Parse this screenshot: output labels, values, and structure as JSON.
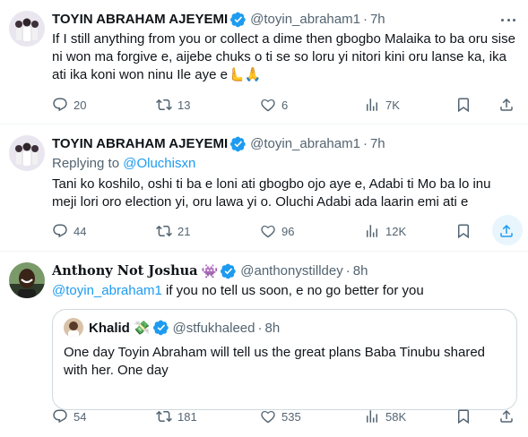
{
  "tweets": [
    {
      "name": "TOYIN ABRAHAM AJEYEMI",
      "handle": "@toyin_abraham1",
      "dot": "·",
      "time": "7h",
      "text": "If I still anything from you or collect a dime then gbogbo Malaika to ba oru sise ni won ma forgive e, aijebe chuks o ti se so loru yi nitori kini oru lanse ka, ika ati ika koni won ninu Ile aye e🫷🙏",
      "actions": {
        "replies": "20",
        "reposts": "13",
        "likes": "6",
        "views": "7K"
      }
    },
    {
      "name": "TOYIN ABRAHAM AJEYEMI",
      "handle": "@toyin_abraham1",
      "dot": "·",
      "time": "7h",
      "replying_label": "Replying to",
      "replying_handle": "@Oluchisxn",
      "text": "Tani ko koshilo, oshi ti ba e loni ati gbogbo ojo aye e, Adabi ti Mo ba lo inu meji lori oro election yi, oru lawa yi o. Oluchi Adabi ada laarin emi ati e",
      "actions": {
        "replies": "44",
        "reposts": "21",
        "likes": "96",
        "views": "12K"
      }
    },
    {
      "name": "Anthony Not Joshua",
      "name_emoji": "👾",
      "handle": "@anthonystilldey",
      "dot": "·",
      "time": "8h",
      "mention": "@toyin_abraham1",
      "text": " if you no tell us soon, e no go better for you",
      "quote": {
        "name": "Khalid",
        "name_emoji": "💸",
        "handle": "@stfukhaleed",
        "dot": "·",
        "time": "8h",
        "text": "One day Toyin Abraham will tell us the great plans Baba Tinubu shared with her. One day"
      },
      "actions": {
        "replies": "54",
        "reposts": "181",
        "likes": "535",
        "views": "58K"
      }
    }
  ],
  "icons": {
    "reply": "reply-icon",
    "repost": "repost-icon",
    "like": "heart-icon",
    "views": "views-icon",
    "bookmark": "bookmark-icon",
    "share": "share-icon",
    "verified": "verified-badge-icon",
    "more": "more-icon"
  },
  "colors": {
    "text": "#0f1419",
    "secondary": "#536471",
    "link": "#1d9bf0",
    "verified_gold": "#e2b719",
    "verified_blue": "#1d9bf0",
    "border": "#eff3f4"
  }
}
